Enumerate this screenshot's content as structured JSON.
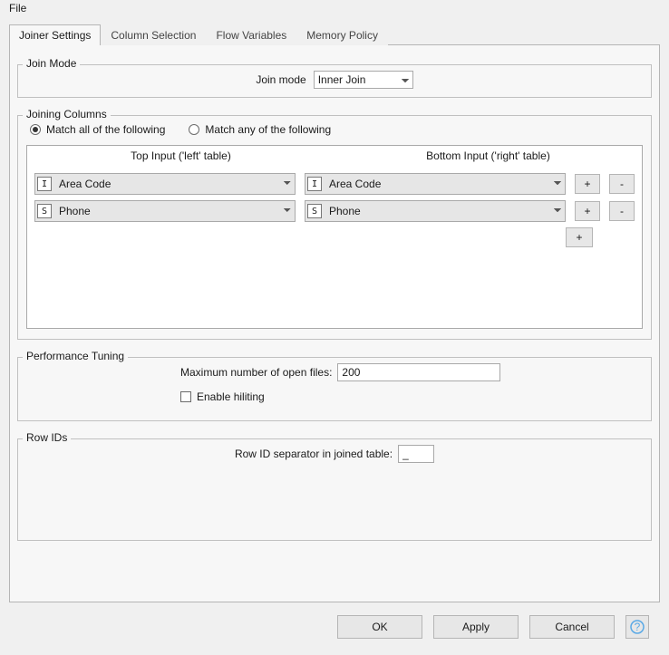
{
  "menubar": {
    "file": "File"
  },
  "tabs": [
    {
      "label": "Joiner Settings"
    },
    {
      "label": "Column Selection"
    },
    {
      "label": "Flow Variables"
    },
    {
      "label": "Memory Policy"
    }
  ],
  "join_mode": {
    "group_title": "Join Mode",
    "label": "Join mode",
    "value": "Inner Join"
  },
  "joining_columns": {
    "group_title": "Joining Columns",
    "match_all_label": "Match all of the following",
    "match_any_label": "Match any of the following",
    "match_mode": "all",
    "header_left": "Top Input ('left' table)",
    "header_right": "Bottom Input ('right' table)",
    "rows": [
      {
        "left_type": "I",
        "left_value": "Area Code",
        "right_type": "I",
        "right_value": "Area Code"
      },
      {
        "left_type": "S",
        "left_value": "Phone",
        "right_type": "S",
        "right_value": "Phone"
      }
    ],
    "add_symbol": "+",
    "remove_symbol": "-",
    "extra_add_symbol": "+"
  },
  "performance": {
    "group_title": "Performance Tuning",
    "max_files_label": "Maximum number of open files:",
    "max_files_value": "200",
    "enable_hiliting_label": "Enable hiliting",
    "enable_hiliting_checked": false
  },
  "row_ids": {
    "group_title": "Row IDs",
    "sep_label": "Row ID separator in joined table:",
    "sep_value": "_"
  },
  "footer": {
    "ok": "OK",
    "apply": "Apply",
    "cancel": "Cancel"
  }
}
